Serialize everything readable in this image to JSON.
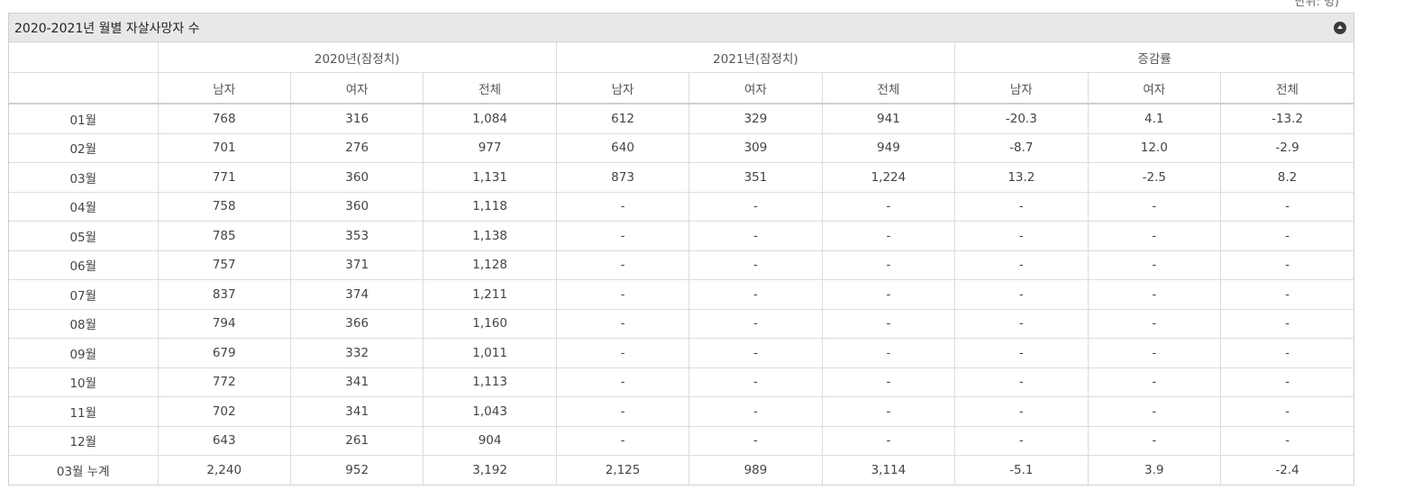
{
  "unit_note": "단위: 명)",
  "panel": {
    "title": "2020-2021년 월별 자살사망자 수"
  },
  "groups": [
    "2020년(잠정치)",
    "2021년(잠정치)",
    "증감률"
  ],
  "subheaders": [
    "남자",
    "여자",
    "전체",
    "남자",
    "여자",
    "전체",
    "남자",
    "여자",
    "전체"
  ],
  "rows": [
    [
      "01월",
      "768",
      "316",
      "1,084",
      "612",
      "329",
      "941",
      "-20.3",
      "4.1",
      "-13.2"
    ],
    [
      "02월",
      "701",
      "276",
      "977",
      "640",
      "309",
      "949",
      "-8.7",
      "12.0",
      "-2.9"
    ],
    [
      "03월",
      "771",
      "360",
      "1,131",
      "873",
      "351",
      "1,224",
      "13.2",
      "-2.5",
      "8.2"
    ],
    [
      "04월",
      "758",
      "360",
      "1,118",
      "-",
      "-",
      "-",
      "-",
      "-",
      "-"
    ],
    [
      "05월",
      "785",
      "353",
      "1,138",
      "-",
      "-",
      "-",
      "-",
      "-",
      "-"
    ],
    [
      "06월",
      "757",
      "371",
      "1,128",
      "-",
      "-",
      "-",
      "-",
      "-",
      "-"
    ],
    [
      "07월",
      "837",
      "374",
      "1,211",
      "-",
      "-",
      "-",
      "-",
      "-",
      "-"
    ],
    [
      "08월",
      "794",
      "366",
      "1,160",
      "-",
      "-",
      "-",
      "-",
      "-",
      "-"
    ],
    [
      "09월",
      "679",
      "332",
      "1,011",
      "-",
      "-",
      "-",
      "-",
      "-",
      "-"
    ],
    [
      "10월",
      "772",
      "341",
      "1,113",
      "-",
      "-",
      "-",
      "-",
      "-",
      "-"
    ],
    [
      "11월",
      "702",
      "341",
      "1,043",
      "-",
      "-",
      "-",
      "-",
      "-",
      "-"
    ],
    [
      "12월",
      "643",
      "261",
      "904",
      "-",
      "-",
      "-",
      "-",
      "-",
      "-"
    ],
    [
      "03월 누계",
      "2,240",
      "952",
      "3,192",
      "2,125",
      "989",
      "3,114",
      "-5.1",
      "3.9",
      "-2.4"
    ]
  ]
}
